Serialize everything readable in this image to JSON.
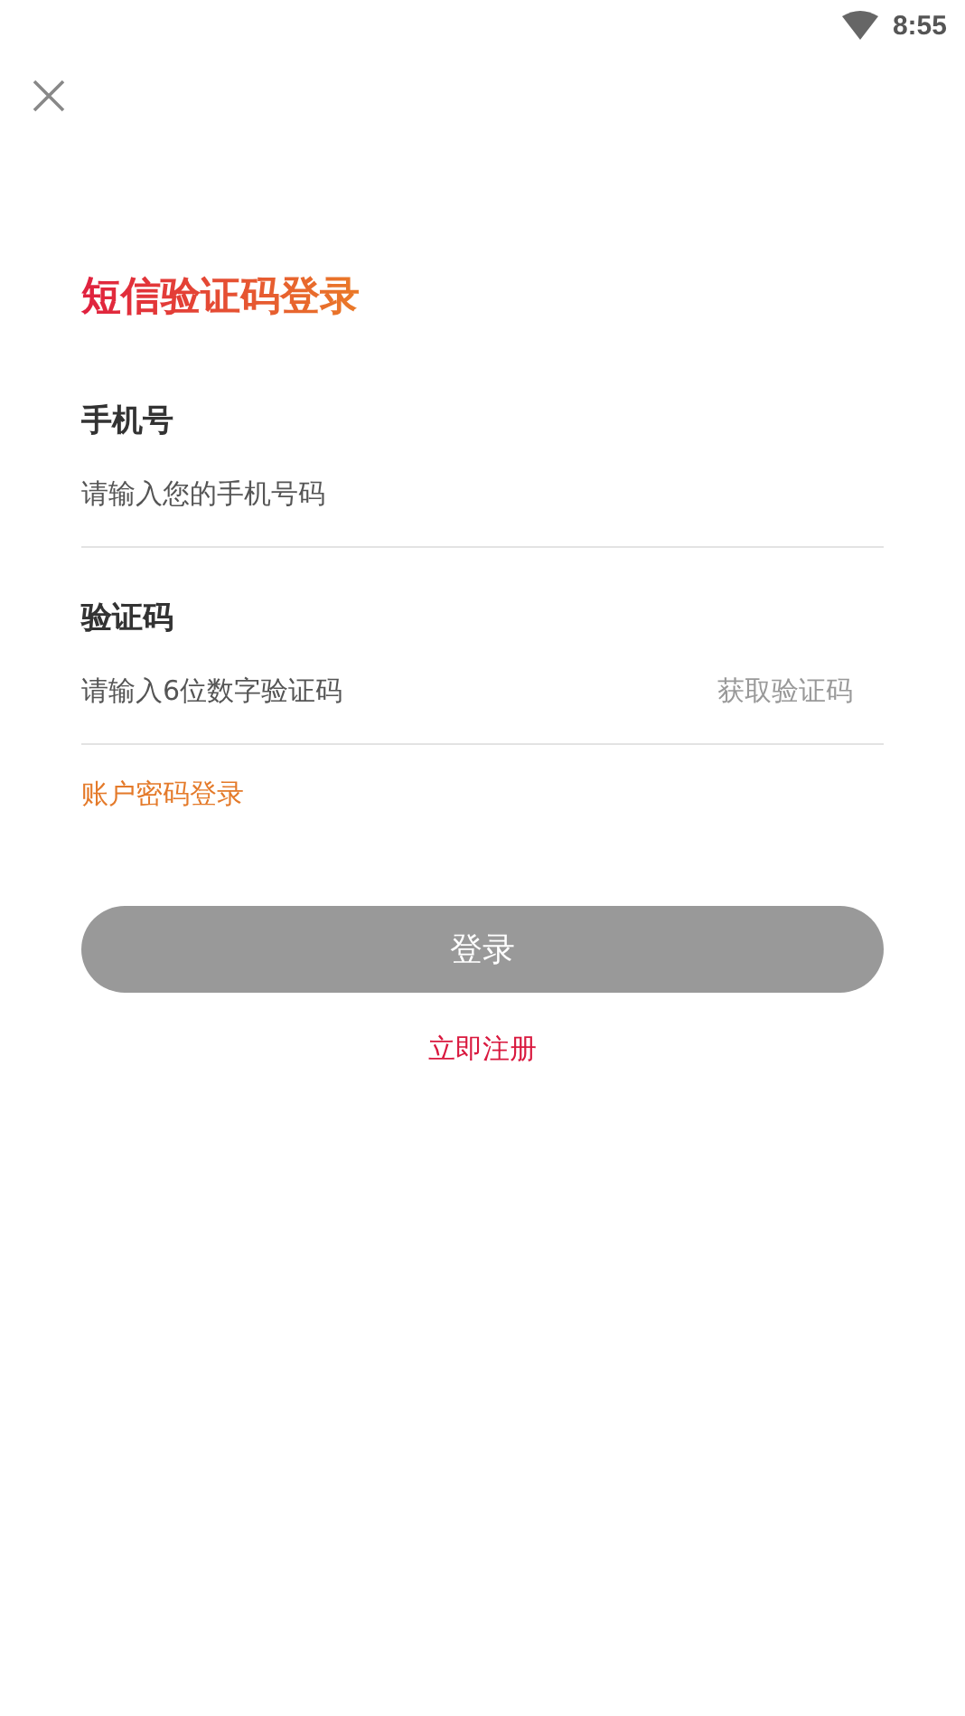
{
  "status_bar": {
    "time": "8:55"
  },
  "title": "短信验证码登录",
  "fields": [
    {
      "label": "手机号",
      "placeholder": "请输入您的手机号码"
    },
    {
      "label": "验证码",
      "placeholder": "请输入6位数字验证码",
      "action": "获取验证码"
    }
  ],
  "password_login_link": "账户密码登录",
  "login_button": {
    "label": "登录",
    "disabled": true
  },
  "register_link": "立即注册"
}
